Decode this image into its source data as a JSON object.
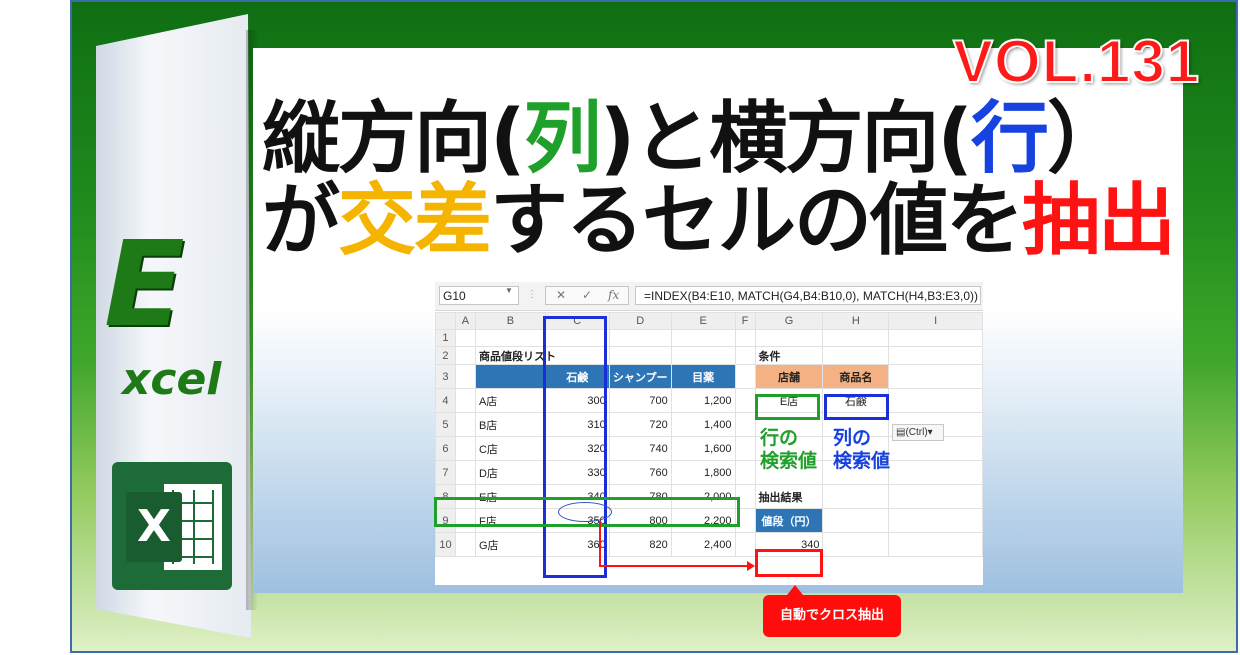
{
  "badge": {
    "volume": "VOL.131"
  },
  "title": {
    "line1": {
      "p1": "縦方向(",
      "p2": "列",
      "p3": ")と横方向(",
      "p4": "行",
      "p5": "）"
    },
    "line2": {
      "p1": "が",
      "p2": "交差",
      "p3": "するセルの値を",
      "p4": "抽出"
    }
  },
  "logo": {
    "big_letter": "E",
    "word": "xcel",
    "icon_letter": "X"
  },
  "formula_bar": {
    "name_box": "G10",
    "dropdown": "▼",
    "separator": "⋮",
    "cancel": "✕",
    "enter": "✓",
    "fx": "fx",
    "formula": "=INDEX(B4:E10, MATCH(G4,B4:B10,0), MATCH(H4,B3:E3,0))"
  },
  "columns": [
    "A",
    "B",
    "C",
    "D",
    "E",
    "F",
    "G",
    "H",
    "I"
  ],
  "rows": [
    "1",
    "2",
    "3",
    "4",
    "5",
    "6",
    "7",
    "8",
    "9",
    "10"
  ],
  "table": {
    "title": "商品値段リスト",
    "headers": [
      "石鹸",
      "シャンプー",
      "目薬"
    ],
    "data": [
      {
        "store": "A店",
        "v1": "300",
        "v2": "700",
        "v3": "1,200"
      },
      {
        "store": "B店",
        "v1": "310",
        "v2": "720",
        "v3": "1,400"
      },
      {
        "store": "C店",
        "v1": "320",
        "v2": "740",
        "v3": "1,600"
      },
      {
        "store": "D店",
        "v1": "330",
        "v2": "760",
        "v3": "1,800"
      },
      {
        "store": "E店",
        "v1": "340",
        "v2": "780",
        "v3": "2,000"
      },
      {
        "store": "F店",
        "v1": "350",
        "v2": "800",
        "v3": "2,200"
      },
      {
        "store": "G店",
        "v1": "360",
        "v2": "820",
        "v3": "2,400"
      }
    ]
  },
  "conditions": {
    "label": "条件",
    "store_header": "店舗",
    "product_header": "商品名",
    "store_value": "E店",
    "product_value": "石鹸"
  },
  "result": {
    "label": "抽出結果",
    "header": "値段（円）",
    "value": "340"
  },
  "annotations": {
    "row_lookup_1": "行の",
    "row_lookup_2": "検索値",
    "col_lookup_1": "列の",
    "col_lookup_2": "検索値",
    "callout": "自動でクロス抽出",
    "paste_options": "(Ctrl)"
  },
  "colors": {
    "green": "#1fa02a",
    "blue": "#1642e0",
    "red": "#ff1212",
    "yellow": "#f5b400",
    "header_blue": "#2e75b6",
    "header_orange": "#f4b183"
  }
}
